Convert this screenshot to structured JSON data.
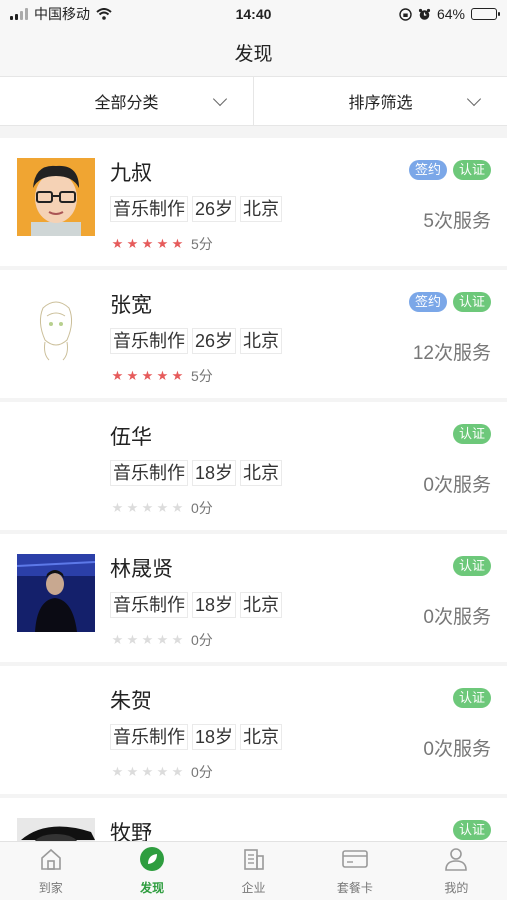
{
  "status": {
    "carrier": "中国移动",
    "time": "14:40",
    "battery": "64%",
    "battery_level": 0.64
  },
  "nav": {
    "title": "发现"
  },
  "filters": [
    {
      "label": "全部分类"
    },
    {
      "label": "排序筛选"
    }
  ],
  "people": [
    {
      "name": "九叔",
      "tags": [
        "音乐制作",
        "26岁",
        "北京"
      ],
      "stars": 5,
      "score": "5分",
      "services": "5次服务",
      "badges": [
        {
          "label": "签约",
          "color": "blue"
        },
        {
          "label": "认证",
          "color": "green"
        }
      ],
      "avatar": "cartoon"
    },
    {
      "name": "张宽",
      "tags": [
        "音乐制作",
        "26岁",
        "北京"
      ],
      "stars": 5,
      "score": "5分",
      "services": "12次服务",
      "badges": [
        {
          "label": "签约",
          "color": "blue"
        },
        {
          "label": "认证",
          "color": "green"
        }
      ],
      "avatar": "sketch"
    },
    {
      "name": "伍华",
      "tags": [
        "音乐制作",
        "18岁",
        "北京"
      ],
      "stars": 0,
      "score": "0分",
      "services": "0次服务",
      "badges": [
        {
          "label": "认证",
          "color": "green"
        }
      ],
      "avatar": "none"
    },
    {
      "name": "林晟贤",
      "tags": [
        "音乐制作",
        "18岁",
        "北京"
      ],
      "stars": 0,
      "score": "0分",
      "services": "0次服务",
      "badges": [
        {
          "label": "认证",
          "color": "green"
        }
      ],
      "avatar": "photo"
    },
    {
      "name": "朱贺",
      "tags": [
        "音乐制作",
        "18岁",
        "北京"
      ],
      "stars": 0,
      "score": "0分",
      "services": "0次服务",
      "badges": [
        {
          "label": "认证",
          "color": "green"
        }
      ],
      "avatar": "none"
    },
    {
      "name": "牧野",
      "tags": [],
      "stars": 0,
      "score": "",
      "services": "",
      "badges": [
        {
          "label": "认证",
          "color": "green"
        }
      ],
      "avatar": "bw"
    }
  ],
  "tabs": [
    {
      "label": "到家",
      "icon": "home-icon",
      "active": false
    },
    {
      "label": "发现",
      "icon": "discover-icon",
      "active": true
    },
    {
      "label": "企业",
      "icon": "building-icon",
      "active": false
    },
    {
      "label": "套餐卡",
      "icon": "card-icon",
      "active": false
    },
    {
      "label": "我的",
      "icon": "user-icon",
      "active": false
    }
  ],
  "colors": {
    "accent": "#2e9d3f",
    "badge_blue": "#7ba7e8",
    "badge_green": "#6dc87a",
    "star_on": "#e65b5b"
  }
}
